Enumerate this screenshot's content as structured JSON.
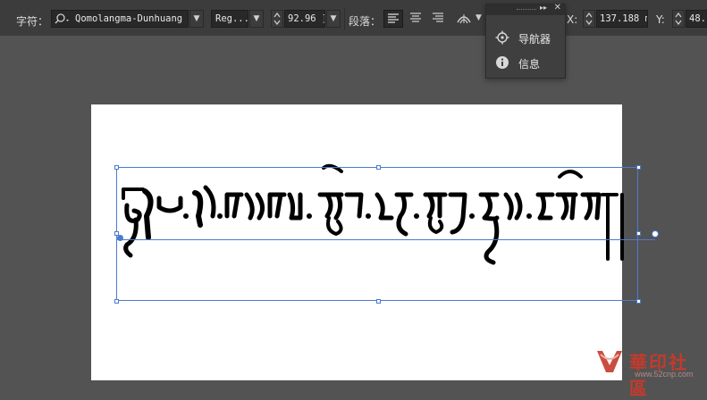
{
  "control_bar": {
    "character_label": "字符：",
    "font_family": "Qomolangma-Dunhuang",
    "font_style": "Reg...",
    "font_size": "92.96 ]",
    "paragraph_label": "段落：",
    "align_buttons": [
      "align-left",
      "align-center",
      "align-right"
    ],
    "active_align": "align-left",
    "x_label": "X:",
    "x_value": "137.188 m",
    "y_label": "Y:",
    "y_value": "48."
  },
  "panel": {
    "items": [
      {
        "label": "导航器",
        "icon": "navigator-icon"
      },
      {
        "label": "信息",
        "icon": "info-icon"
      }
    ]
  },
  "canvas": {
    "selection_color": "#4a7bd0",
    "text_color": "#000000"
  },
  "watermark": {
    "title": "華印社區",
    "url": "www.52cnp.com"
  }
}
